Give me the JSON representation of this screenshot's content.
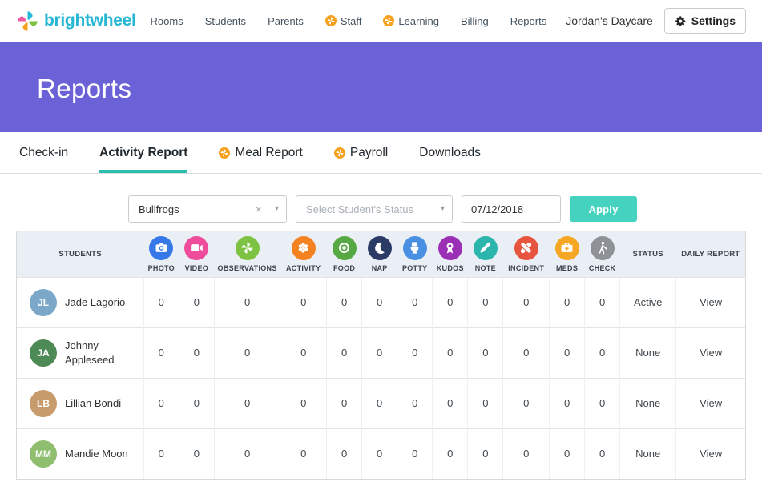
{
  "colors": {
    "brand_color": "#25B7D3",
    "hero_purple": "#6A62D6",
    "accent_teal": "#2BC0AE",
    "apply_button": "#45D3BF",
    "badge_orange": "#F7A11E",
    "table_header_bg": "#E9EFF4"
  },
  "nav": {
    "brand": "brightwheel",
    "items": [
      {
        "label": "Rooms",
        "badge": false
      },
      {
        "label": "Students",
        "badge": false
      },
      {
        "label": "Parents",
        "badge": false
      },
      {
        "label": "Staff",
        "badge": true
      },
      {
        "label": "Learning",
        "badge": true
      },
      {
        "label": "Billing",
        "badge": false
      },
      {
        "label": "Reports",
        "badge": false
      }
    ],
    "account": "Jordan's Daycare",
    "settings_label": "Settings"
  },
  "header": {
    "title": "Reports"
  },
  "tabs": [
    {
      "label": "Check-in",
      "active": false,
      "badge": false
    },
    {
      "label": "Activity Report",
      "active": true,
      "badge": false
    },
    {
      "label": "Meal Report",
      "active": false,
      "badge": true
    },
    {
      "label": "Payroll",
      "active": false,
      "badge": true
    },
    {
      "label": "Downloads",
      "active": false,
      "badge": false
    }
  ],
  "filters": {
    "room_value": "Bullfrogs",
    "status_placeholder": "Select Student's Status",
    "date_value": "07/12/2018",
    "apply_label": "Apply"
  },
  "table": {
    "students_header": "STUDENTS",
    "status_header": "STATUS",
    "daily_report_header": "DAILY REPORT",
    "icon_columns": [
      {
        "label": "PHOTO",
        "icon": "photo-camera-icon",
        "glyph": "camera",
        "color": "#3778E8"
      },
      {
        "label": "VIDEO",
        "icon": "video-camera-icon",
        "glyph": "video",
        "color": "#EF4D9B"
      },
      {
        "label": "OBSERVATIONS",
        "icon": "observations-pinwheel-icon",
        "glyph": "pinwheel",
        "color": "#7DC242"
      },
      {
        "label": "ACTIVITY",
        "icon": "activity-flower-icon",
        "glyph": "flower",
        "color": "#F58220"
      },
      {
        "label": "FOOD",
        "icon": "food-plate-icon",
        "glyph": "plate",
        "color": "#56A843"
      },
      {
        "label": "NAP",
        "icon": "nap-moon-icon",
        "glyph": "moon",
        "color": "#2C3B66"
      },
      {
        "label": "POTTY",
        "icon": "potty-toilet-icon",
        "glyph": "toilet",
        "color": "#4A90E2"
      },
      {
        "label": "KUDOS",
        "icon": "kudos-ribbon-icon",
        "glyph": "ribbon",
        "color": "#9B2FB5"
      },
      {
        "label": "NOTE",
        "icon": "note-pencil-icon",
        "glyph": "pencil",
        "color": "#2CB5AC"
      },
      {
        "label": "INCIDENT",
        "icon": "incident-bandage-icon",
        "glyph": "bandage",
        "color": "#E8553E"
      },
      {
        "label": "MEDS",
        "icon": "meds-kit-icon",
        "glyph": "medkit",
        "color": "#F5A623"
      },
      {
        "label": "CHECK",
        "icon": "check-walker-icon",
        "glyph": "walker",
        "color": "#8E9297"
      }
    ],
    "rows": [
      {
        "name": "Jade Lagorio",
        "counts": [
          0,
          0,
          0,
          0,
          0,
          0,
          0,
          0,
          0,
          0,
          0,
          0
        ],
        "status": "Active",
        "report": "View"
      },
      {
        "name": "Johnny Appleseed",
        "counts": [
          0,
          0,
          0,
          0,
          0,
          0,
          0,
          0,
          0,
          0,
          0,
          0
        ],
        "status": "None",
        "report": "View"
      },
      {
        "name": "Lillian Bondi",
        "counts": [
          0,
          0,
          0,
          0,
          0,
          0,
          0,
          0,
          0,
          0,
          0,
          0
        ],
        "status": "None",
        "report": "View"
      },
      {
        "name": "Mandie Moon",
        "counts": [
          0,
          0,
          0,
          0,
          0,
          0,
          0,
          0,
          0,
          0,
          0,
          0
        ],
        "status": "None",
        "report": "View"
      }
    ]
  }
}
